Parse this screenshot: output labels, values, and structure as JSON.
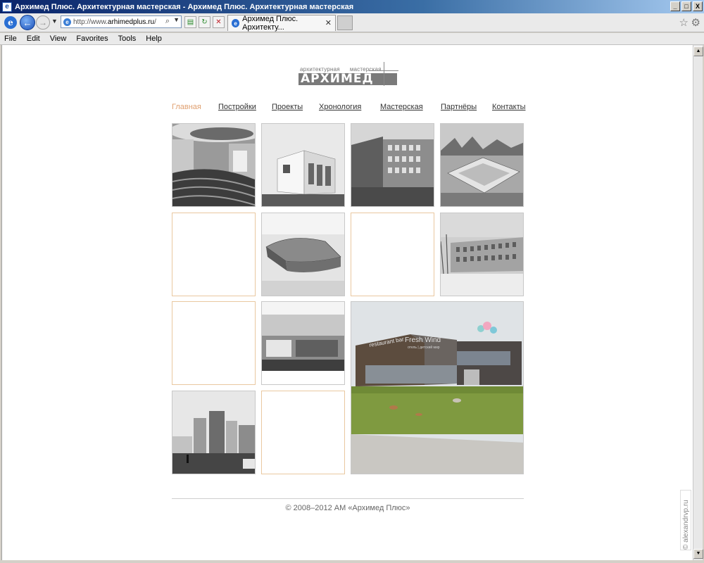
{
  "window": {
    "title": "Архимед Плюс. Архитектурная мастерская - Архимед Плюс. Архитектурная мастерская",
    "buttons": [
      "_",
      "□",
      "X"
    ]
  },
  "browser": {
    "address_prefix": "http://www.",
    "address_host": "arhimedplus.ru",
    "address_suffix": "/",
    "tab_title": "Архимед Плюс. Архитекту...",
    "menu": [
      "File",
      "Edit",
      "View",
      "Favorites",
      "Tools",
      "Help"
    ]
  },
  "site": {
    "logo": {
      "small_word_1": "архитектурная",
      "small_word_2": "мастерская",
      "main": "АРХИМЕД"
    },
    "nav": [
      "Главная",
      "Постройки",
      "Проекты",
      "Хронология",
      "Мастерская",
      "Партнёры",
      "Контакты"
    ],
    "active_nav": "Главная",
    "feature_photo": {
      "signs": [
        "restaurant bar",
        "Fresh Wind",
        "отель | детский мир"
      ]
    },
    "footer": "© 2008–2012 АМ «Архимед Плюс»"
  },
  "watermark": "© alexandrvp.ru",
  "colors": {
    "accent_nav": "#e0a070",
    "tile_border": "#e9c8a0",
    "title_bar": "#0a246a"
  }
}
